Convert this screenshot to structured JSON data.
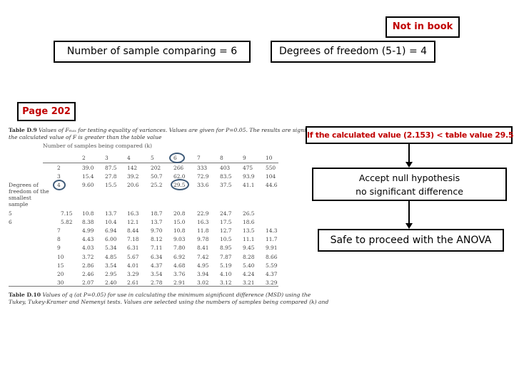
{
  "slide": {
    "not_in_book": "Not in book",
    "sample_count": "Number of sample comparing = 6",
    "degrees_of_freedom": "Degrees of freedom (5-1) = 4",
    "page_ref": "Page 202",
    "accent_color": "#c00000"
  },
  "flowchart": {
    "condition": "If the calculated value (2.153) < table value 29.5",
    "accept_line1": "Accept null hypothesis",
    "accept_line2": "no significant difference",
    "conclusion": "Safe to proceed with the ANOVA"
  },
  "table_d9": {
    "caption_bold": "Table D.9",
    "caption_text": " Values of Fₘₐₓ for testing equality of variances. Values are given for P=0.05. The results are significant if",
    "caption_line2": "the calculated value of F is greater than the table value",
    "column_group_label": "Number of samples being compared (k)",
    "row_group_label": "Degrees of freedom of the smallest sample",
    "columns": [
      "2",
      "3",
      "4",
      "5",
      "6",
      "7",
      "8",
      "9",
      "10"
    ],
    "circled_column": "6",
    "circled_row": "4",
    "circled_value": "29.5",
    "rows": [
      {
        "df": "2",
        "values": [
          "39.0",
          "87.5",
          "142",
          "202",
          "266",
          "333",
          "403",
          "475",
          "550"
        ]
      },
      {
        "df": "3",
        "values": [
          "15.4",
          "27.8",
          "39.2",
          "50.7",
          "62.0",
          "72.9",
          "83.5",
          "93.9",
          "104"
        ]
      },
      {
        "df": "4",
        "values": [
          "9.60",
          "15.5",
          "20.6",
          "25.2",
          "29.5",
          "33.6",
          "37.5",
          "41.1",
          "44.6"
        ]
      },
      {
        "df": "5",
        "values": [
          "7.15",
          "10.8",
          "13.7",
          "16.3",
          "18.7",
          "20.8",
          "22.9",
          "24.7",
          "26.5"
        ]
      },
      {
        "df": "6",
        "values": [
          "5.82",
          "8.38",
          "10.4",
          "12.1",
          "13.7",
          "15.0",
          "16.3",
          "17.5",
          "18.6"
        ]
      },
      {
        "df": "7",
        "values": [
          "4.99",
          "6.94",
          "8.44",
          "9.70",
          "10.8",
          "11.8",
          "12.7",
          "13.5",
          "14.3"
        ]
      },
      {
        "df": "8",
        "values": [
          "4.43",
          "6.00",
          "7.18",
          "8.12",
          "9.03",
          "9.78",
          "10.5",
          "11.1",
          "11.7"
        ]
      },
      {
        "df": "9",
        "values": [
          "4.03",
          "5.34",
          "6.31",
          "7.11",
          "7.80",
          "8.41",
          "8.95",
          "9.45",
          "9.91"
        ]
      },
      {
        "df": "10",
        "values": [
          "3.72",
          "4.85",
          "5.67",
          "6.34",
          "6.92",
          "7.42",
          "7.87",
          "8.28",
          "8.66"
        ]
      },
      {
        "df": "15",
        "values": [
          "2.86",
          "3.54",
          "4.01",
          "4.37",
          "4.68",
          "4.95",
          "5.19",
          "5.40",
          "5.59"
        ]
      },
      {
        "df": "20",
        "values": [
          "2.46",
          "2.95",
          "3.29",
          "3.54",
          "3.76",
          "3.94",
          "4.10",
          "4.24",
          "4.37"
        ]
      },
      {
        "df": "30",
        "values": [
          "2.07",
          "2.40",
          "2.61",
          "2.78",
          "2.91",
          "3.02",
          "3.12",
          "3.21",
          "3.29"
        ]
      }
    ]
  },
  "table_d10": {
    "caption_bold": "Table D.10",
    "caption_text": " Values of q (at P=0.05) for use in calculating the minimum significant difference (MSD) using the",
    "caption_line2": "Tukey, Tukey-Kramer and Nemenyi tests. Values are selected using the numbers of samples being compared (k) and"
  }
}
